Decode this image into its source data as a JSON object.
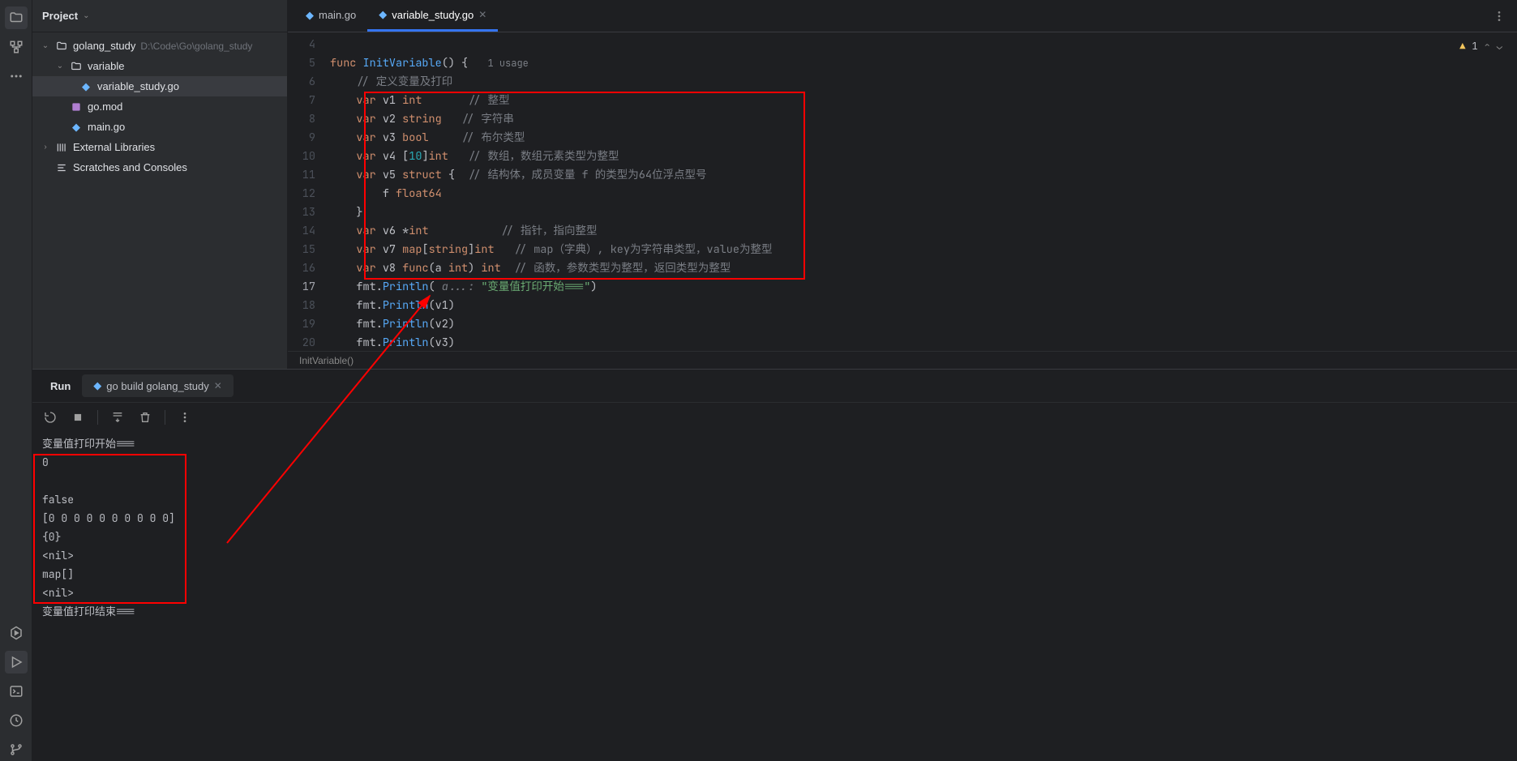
{
  "panel": {
    "title": "Project"
  },
  "project_tree": {
    "root": {
      "name": "golang_study",
      "path": "D:\\Code\\Go\\golang_study"
    },
    "folder_variable": "variable",
    "file_variable_study": "variable_study.go",
    "file_gomod": "go.mod",
    "file_main": "main.go",
    "external": "External Libraries",
    "scratches": "Scratches and Consoles"
  },
  "tabs": {
    "main": "main.go",
    "variable_study": "variable_study.go"
  },
  "warnings": {
    "count": "1"
  },
  "code": {
    "lines": [
      "4",
      "5",
      "6",
      "7",
      "8",
      "9",
      "10",
      "11",
      "12",
      "13",
      "14",
      "15",
      "16",
      "17",
      "18",
      "19",
      "20"
    ],
    "l5_func": "func",
    "l5_name": "InitVariable",
    "l5_paren": "() {",
    "l5_usage": "1 usage",
    "l6_cmt": "// 定义变量及打印",
    "var_kw": "var",
    "l7_v": "v1",
    "l7_t": "int",
    "l7_c": "// 整型",
    "l8_v": "v2",
    "l8_t": "string",
    "l8_c": "// 字符串",
    "l9_v": "v3",
    "l9_t": "bool",
    "l9_c": "// 布尔类型",
    "l10_v": "v4",
    "l10_b": "[",
    "l10_n": "10",
    "l10_e": "]",
    "l10_t": "int",
    "l10_c": "// 数组，数组元素类型为整型",
    "l11_v": "v5",
    "l11_t": "struct",
    "l11_o": " {",
    "l11_c": "// 结构体，成员变量 f 的类型为64位浮点型号",
    "l12_f": "f",
    "l12_t": "float64",
    "l13": "}",
    "l14_v": "v6",
    "l14_s": "*",
    "l14_t": "int",
    "l14_c": "// 指针，指向整型",
    "l15_v": "v7",
    "l15_map": "map",
    "l15_b1": "[",
    "l15_kt": "string",
    "l15_b2": "]",
    "l15_vt": "int",
    "l15_c": "// map（字典）, key为字符串类型，value为整型",
    "l16_v": "v8",
    "l16_func": "func",
    "l16_p1": "(a ",
    "l16_pt": "int",
    "l16_p2": ") ",
    "l16_rt": "int",
    "l16_c": "// 函数，参数类型为整型，返回类型为整型",
    "l17_a": "fmt.",
    "l17_fn": "Println",
    "l17_hint": " a...: ",
    "l17_str": "\"变量值打印开始===\"",
    "l17_end": ")",
    "l18_a": "fmt.",
    "l18_fn": "Println",
    "l18_arg": "(v1)",
    "l19_a": "fmt.",
    "l19_fn": "Println",
    "l19_arg": "(v2)",
    "l20_a": "fmt.",
    "l20_fn": "Println",
    "l20_arg": "(v3)"
  },
  "breadcrumb": {
    "text": "InitVariable()"
  },
  "run": {
    "tab_label": "Run",
    "config_name": "go build golang_study",
    "output": [
      "变量值打印开始===",
      "0",
      "",
      "false",
      "[0 0 0 0 0 0 0 0 0 0]",
      "{0}",
      "<nil>",
      "map[]",
      "<nil>",
      "变量值打印结束==="
    ]
  }
}
